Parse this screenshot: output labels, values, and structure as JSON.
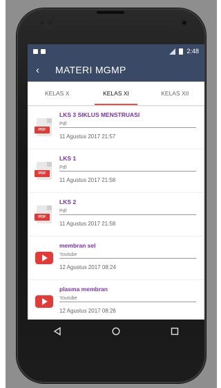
{
  "status_bar": {
    "time": "2:48"
  },
  "app_bar": {
    "title": "MATERI MGMP",
    "back_glyph": "‹"
  },
  "tabs": [
    {
      "label": "KELAS X",
      "active": false
    },
    {
      "label": "KELAS XI",
      "active": true
    },
    {
      "label": "KELAS XII",
      "active": false
    }
  ],
  "items": [
    {
      "icon": "pdf-icon",
      "badge": "PDF",
      "title": "LKS 3 SIKLUS MENSTRUASI",
      "type": "Pdf",
      "date": "11 Agustus 2017 21:57"
    },
    {
      "icon": "pdf-icon",
      "badge": "PDF",
      "title": "LKS 1",
      "type": "Pdf",
      "date": "11 Agustus 2017 21:58"
    },
    {
      "icon": "pdf-icon",
      "badge": "PDF",
      "title": "LKS 2",
      "type": "Pdf",
      "date": "11 Agustus 2017 21:58"
    },
    {
      "icon": "youtube-icon",
      "title": "membran sel",
      "type": "Youtube",
      "date": "12 Agustus 2017 08:24"
    },
    {
      "icon": "youtube-icon",
      "title": "plasma membran",
      "type": "Youtube",
      "date": "12 Agustus 2017 08:26"
    }
  ],
  "colors": {
    "app_bar": "#3a4a66",
    "tab_indicator": "#d9534f",
    "item_title": "#7b2fb5",
    "icon_red": "#e53935"
  }
}
